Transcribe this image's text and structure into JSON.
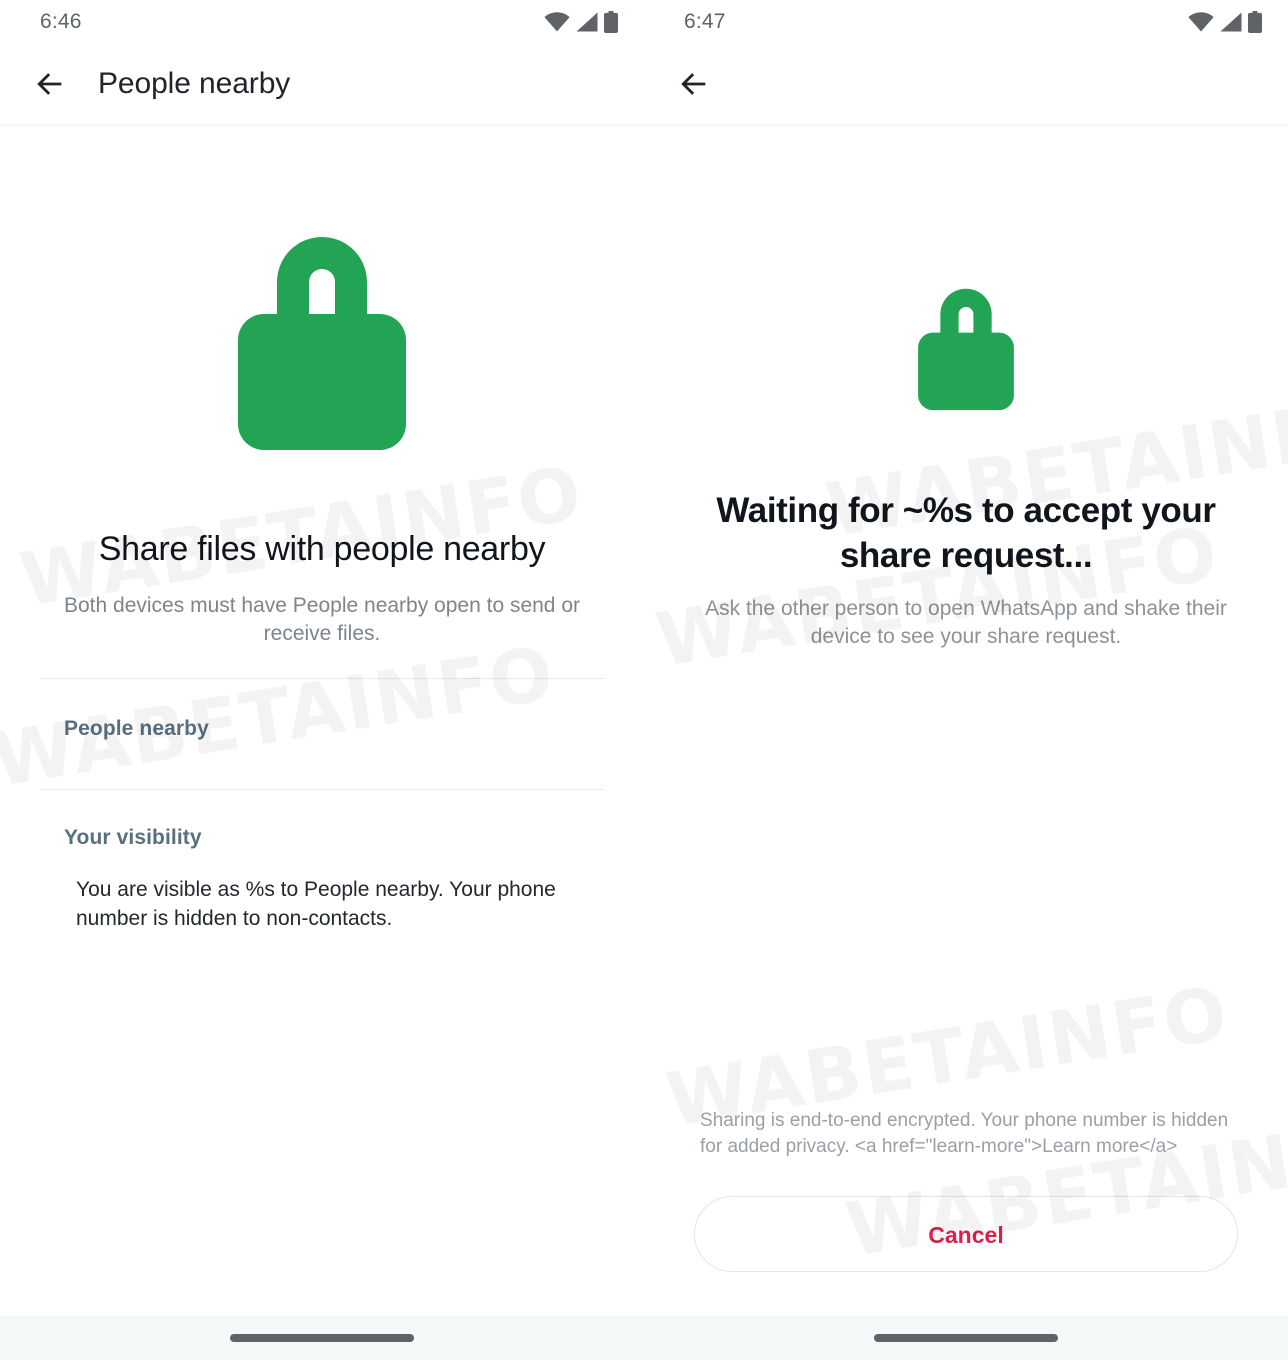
{
  "watermark": {
    "text": "WABETAINFO"
  },
  "colors": {
    "lock_green": "#23a455",
    "cancel_red": "#dd1f4a",
    "section_label": "#58707e",
    "secondary_text": "#7d858c",
    "navbar_bg": "#f5f8f9"
  },
  "screens": [
    {
      "id": "people-nearby-home",
      "status_bar": {
        "time": "6:46",
        "icons": [
          "wifi-icon",
          "cellular-signal-icon",
          "battery-icon"
        ]
      },
      "app_bar": {
        "back_icon": "back-arrow-icon",
        "title": "People nearby"
      },
      "hero": {
        "icon": "lock-icon",
        "title": "Share files with people nearby",
        "subtitle": "Both devices must have People nearby open to send or receive files."
      },
      "sections": [
        {
          "label": "People nearby"
        },
        {
          "label": "Your visibility",
          "body": "You are visible as %s to People nearby. Your phone number is hidden to non-contacts."
        }
      ]
    },
    {
      "id": "waiting-for-accept",
      "status_bar": {
        "time": "6:47",
        "icons": [
          "wifi-icon",
          "cellular-signal-icon",
          "battery-icon"
        ]
      },
      "app_bar": {
        "back_icon": "back-arrow-icon",
        "title": ""
      },
      "hero": {
        "icon": "lock-icon",
        "title": "Waiting for ~%s to accept your share request...",
        "subtitle": "Ask the other person to open WhatsApp and shake their device to see your share request."
      },
      "footer": {
        "note": "Sharing is end-to-end encrypted. Your phone number is hidden for added privacy. <a href=\"learn-more\">Learn more</a>",
        "cancel_label": "Cancel"
      }
    }
  ]
}
